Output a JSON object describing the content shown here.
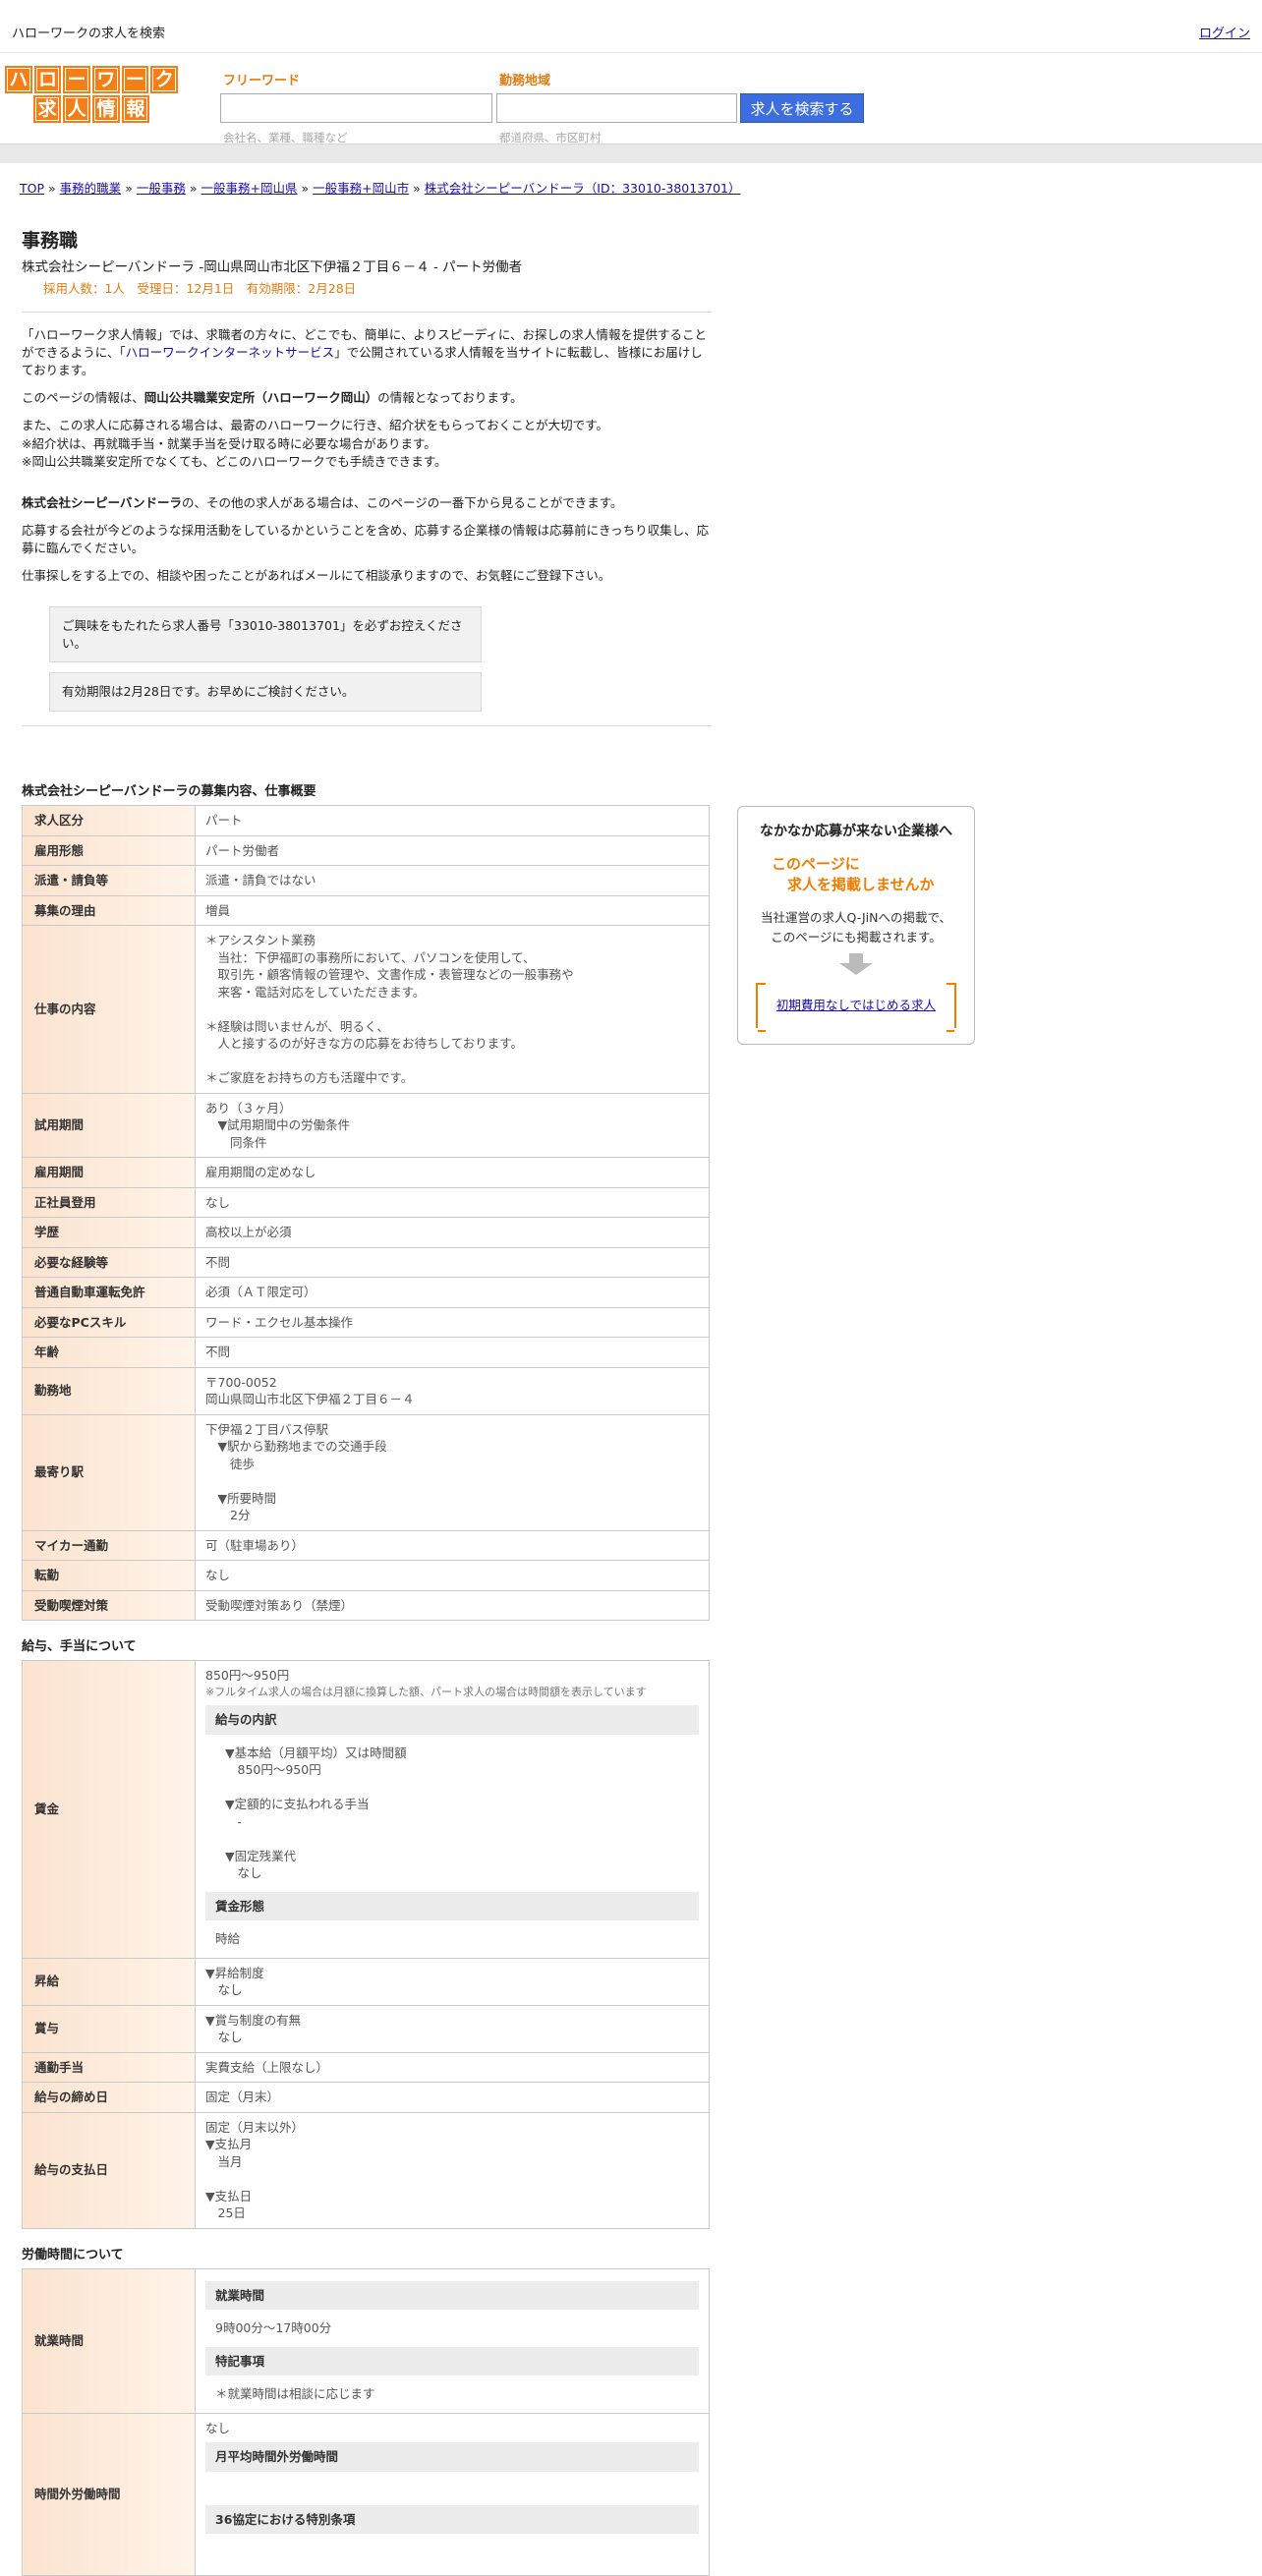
{
  "topbar": {
    "site_title": "ハローワークの求人を検索",
    "login": "ログイン"
  },
  "logo": {
    "row1": [
      "ハ",
      "ロ",
      "ー",
      "ワ",
      "ー",
      "ク"
    ],
    "row2": [
      "求",
      "人",
      "情",
      "報"
    ],
    "brand_color": "#f57f17"
  },
  "search": {
    "free_label": "フリーワード",
    "free_placeholder": "",
    "free_hint": "会社名、業種、職種など",
    "area_label": "勤務地域",
    "area_hint": "都道府県、市区町村",
    "button": "求人を検索する",
    "button_color": "#3d6ee0"
  },
  "breadcrumb": [
    "TOP",
    "事務的職業",
    "一般事務",
    "一般事務+岡山県",
    "一般事務+岡山市",
    "株式会社シーピーバンドーラ（ID：33010-38013701）"
  ],
  "job": {
    "title": "事務職",
    "company_line": "株式会社シーピーバンドーラ -岡山県岡山市北区下伊福２丁目６－４ - パート労働者",
    "meta": "採用人数：1人　受理日：12月1日　有効期限：2月28日",
    "accent_color": "#e07c12"
  },
  "intro": {
    "p1_a": "「ハローワーク求人情報」では、求職者の方々に、どこでも、簡単に、よりスピーディに、お探しの求人情報を提供することができるように、「",
    "p1_link": "ハローワークインターネットサービス",
    "p1_b": "」で公開されている求人情報を当サイトに転載し、皆様にお届けしております。",
    "p2_a": "このページの情報は、",
    "p2_b": "岡山公共職業安定所（ハローワーク岡山）",
    "p2_c": "の情報となっております。",
    "p3": "また、この求人に応募される場合は、最寄のハローワークに行き、紹介状をもらっておくことが大切です。\n※紹介状は、再就職手当・就業手当を受け取る時に必要な場合があります。\n※岡山公共職業安定所でなくても、どこのハローワークでも手続きできます。",
    "p4_a": "株式会社シーピーバンドーラ",
    "p4_b": "の、その他の求人がある場合は、このページの一番下から見ることができます。",
    "p5": "応募する会社が今どのような採用活動をしているかということを含め、応募する企業様の情報は応募前にきっちり収集し、応募に臨んでください。",
    "p6": "仕事探しをする上での、相談や困ったことがあればメールにて相談承りますので、お気軽にご登録下さい。",
    "notice1": "ご興味をもたれたら求人番号「33010-38013701」を必ずお控えください。",
    "notice2": "有効期限は2月28日です。お早めにご検討ください。"
  },
  "summary": {
    "title": "株式会社シーピーバンドーラの募集内容、仕事概要",
    "rows": [
      {
        "label": "求人区分",
        "value": "パート"
      },
      {
        "label": "雇用形態",
        "value": "パート労働者"
      },
      {
        "label": "派遣・請負等",
        "value": "派遣・請負ではない"
      },
      {
        "label": "募集の理由",
        "value": "増員"
      },
      {
        "label": "仕事の内容",
        "value": "＊アシスタント業務\n　当社：下伊福町の事務所において、パソコンを使用して、\n　取引先・顧客情報の管理や、文書作成・表管理などの一般事務や\n　来客・電話対応をしていただきます。\n\n＊経験は問いませんが、明るく、\n　人と接するのが好きな方の応募をお待ちしております。\n\n＊ご家庭をお持ちの方も活躍中です。"
      },
      {
        "label": "試用期間",
        "value": "あり（３ヶ月）\n　▼試用期間中の労働条件\n　　同条件"
      },
      {
        "label": "雇用期間",
        "value": "雇用期間の定めなし"
      },
      {
        "label": "正社員登用",
        "value": "なし"
      },
      {
        "label": "学歴",
        "value": "高校以上が必須"
      },
      {
        "label": "必要な経験等",
        "value": "不問"
      },
      {
        "label": "普通自動車運転免許",
        "value": "必須（ＡＴ限定可）"
      },
      {
        "label": "必要なPCスキル",
        "value": "ワード・エクセル基本操作"
      },
      {
        "label": "年齢",
        "value": "不問"
      },
      {
        "label": "勤務地",
        "value": "〒700-0052\n岡山県岡山市北区下伊福２丁目６－４"
      },
      {
        "label": "最寄り駅",
        "value": "下伊福２丁目バス停駅\n　▼駅から勤務地までの交通手段\n　　徒歩\n\n　▼所要時間\n　　2分"
      },
      {
        "label": "マイカー通勤",
        "value": "可（駐車場あり）"
      },
      {
        "label": "転勤",
        "value": "なし"
      },
      {
        "label": "受動喫煙対策",
        "value": "受動喫煙対策あり（禁煙）"
      }
    ]
  },
  "salary": {
    "title": "給与、手当について",
    "wage_label": "賃金",
    "wage_value": "850円〜950円",
    "wage_note": "※フルタイム求人の場合は月額に換算した額、パート求人の場合は時間額を表示しています",
    "breakdown_head": "給与の内訳",
    "breakdown": "▼基本給（月額平均）又は時間額\n　850円〜950円\n\n▼定額的に支払われる手当\n　-\n\n▼固定残業代\n　なし",
    "form_head": "賃金形態",
    "form_value": "時給",
    "raise_label": "昇給",
    "raise_value": "▼昇給制度\n　なし",
    "bonus_label": "賞与",
    "bonus_value": "▼賞与制度の有無\n　なし",
    "commute_label": "通勤手当",
    "commute_value": "実費支給（上限なし）",
    "cutoff_label": "給与の締め日",
    "cutoff_value": "固定（月末）",
    "payday_label": "給与の支払日",
    "payday_value": "固定（月末以外）\n▼支払月\n　当月\n\n▼支払日\n　25日"
  },
  "hours": {
    "title": "労働時間について",
    "work_label": "就業時間",
    "work_head": "就業時間",
    "work_value": "9時00分〜17時00分",
    "note_head": "特記事項",
    "note_value": "＊就業時間は相談に応じます",
    "ot_label": "時間外労働時間",
    "ot_value": "なし",
    "ot_head1": "月平均時間外労働時間",
    "ot_head2": "36協定における特別条項"
  },
  "sidebar": {
    "title": "なかなか応募が来ない企業様へ",
    "catch1": "このページに",
    "catch2": "求人を掲載しませんか",
    "desc1": "当社運営の求人Q-JiNへの掲載で、",
    "desc2": "このページにも掲載されます。",
    "link": "初期費用なしではじめる求人",
    "accent": "#f07d00"
  }
}
